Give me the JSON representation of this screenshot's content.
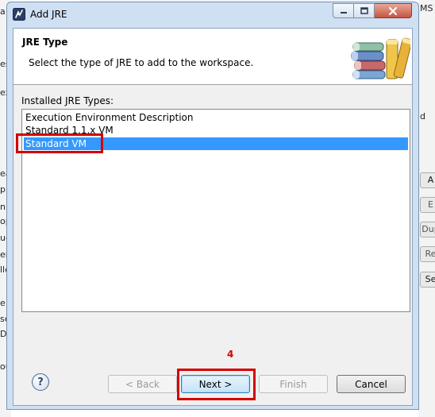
{
  "window": {
    "title": "Add JRE"
  },
  "header": {
    "title": "JRE Type",
    "description": "Select the type of JRE to add to the workspace."
  },
  "installed_label": "Installed JRE Types:",
  "jre_types": [
    {
      "label": "Execution Environment Description",
      "selected": false
    },
    {
      "label": "Standard 1.1.x VM",
      "selected": false
    },
    {
      "label": "Standard VM",
      "selected": true
    }
  ],
  "annotation": {
    "step_number": "4"
  },
  "buttons": {
    "back": "< Back",
    "next": "Next >",
    "finish": "Finish",
    "cancel": "Cancel",
    "help": "?"
  },
  "background": {
    "right_text": "MS",
    "right_buttons": [
      "A",
      "E",
      "Dup",
      "Re",
      "Se"
    ],
    "right_misc": [
      "d"
    ],
    "left_fragments": [
      "a",
      "es",
      "ex",
      "ea",
      "p",
      "n",
      "op",
      "ug",
      "er",
      "lle",
      "e",
      "se",
      "De",
      "ou"
    ]
  },
  "colors": {
    "selection": "#3399ff",
    "annotation_red": "#d40000",
    "title_bar": "#cfe0f3"
  },
  "icons": {
    "window_icon": "eclipse-icon",
    "header_icon": "books-icon",
    "help": "help-icon"
  }
}
